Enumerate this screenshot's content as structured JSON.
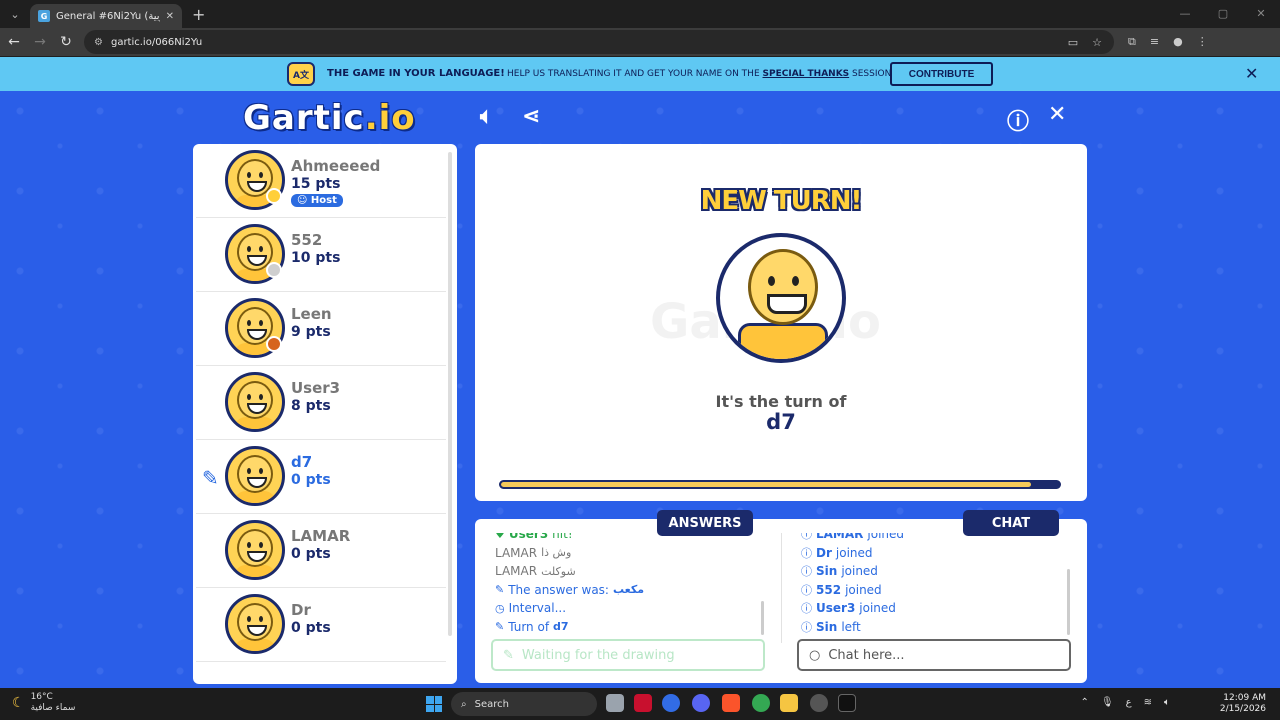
{
  "browser": {
    "tab_title": "General #6Ni2Yu (العربية) - Gartic",
    "favicon_letter": "G",
    "url": "gartic.io/066Ni2Yu"
  },
  "banner": {
    "title": "THE GAME IN YOUR LANGUAGE!",
    "text_before": "HELP US TRANSLATING IT AND GET YOUR NAME ON THE",
    "link": "SPECIAL THANKS",
    "text_after": "SESSION",
    "contribute": "CONTRIBUTE"
  },
  "logo": {
    "main": "Gartic",
    "suffix": ".io"
  },
  "players": [
    {
      "name": "Ahmeeeed",
      "pts": "15 pts",
      "host": "Host",
      "dot": "#ffcf3a",
      "active": false
    },
    {
      "name": "552",
      "pts": "10 pts",
      "host": null,
      "dot": "#cfcfcf",
      "active": false
    },
    {
      "name": "Leen",
      "pts": "9 pts",
      "host": null,
      "dot": "#d6641e",
      "active": false
    },
    {
      "name": "User3",
      "pts": "8 pts",
      "host": null,
      "dot": null,
      "active": false
    },
    {
      "name": "d7",
      "pts": "0 pts",
      "host": null,
      "dot": null,
      "active": true
    },
    {
      "name": "LAMAR",
      "pts": "0 pts",
      "host": null,
      "dot": null,
      "active": false
    },
    {
      "name": "Dr",
      "pts": "0 pts",
      "host": null,
      "dot": null,
      "active": false
    }
  ],
  "canvas": {
    "heading": "NEW TURN!",
    "turn_text": "It's the turn of",
    "turn_player": "d7",
    "watermark": "Gartic.io",
    "timer_fraction": 0.95
  },
  "answers": {
    "label": "ANSWERS",
    "lines": [
      {
        "icon": "heart",
        "who": "User3",
        "text": "hit!",
        "style": "green"
      },
      {
        "icon": "",
        "who": "LAMAR",
        "text": "وش ذا",
        "style": "grey"
      },
      {
        "icon": "",
        "who": "LAMAR",
        "text": "شوكلت",
        "style": "grey"
      },
      {
        "icon": "pencil",
        "who": "",
        "text": "The answer was:",
        "extra": "مكعب",
        "style": "blue"
      },
      {
        "icon": "clock",
        "who": "",
        "text": "Interval...",
        "style": "blue"
      },
      {
        "icon": "pencil",
        "who": "",
        "text": "Turn of",
        "extra": "d7",
        "style": "blue"
      }
    ],
    "placeholder": "Waiting for the drawing"
  },
  "chat": {
    "label": "CHAT",
    "lines": [
      {
        "who": "LAMAR",
        "text": "joined"
      },
      {
        "who": "Dr",
        "text": "joined"
      },
      {
        "who": "Sin",
        "text": "joined"
      },
      {
        "who": "552",
        "text": "joined"
      },
      {
        "who": "User3",
        "text": "joined"
      },
      {
        "who": "Sin",
        "text": "left"
      }
    ],
    "placeholder": "Chat here..."
  },
  "taskbar": {
    "temp": "16°C",
    "weather": "سماء صافية",
    "search": "Search",
    "lang": "ع",
    "time": "12:09 AM",
    "date": "2/15/2026"
  }
}
